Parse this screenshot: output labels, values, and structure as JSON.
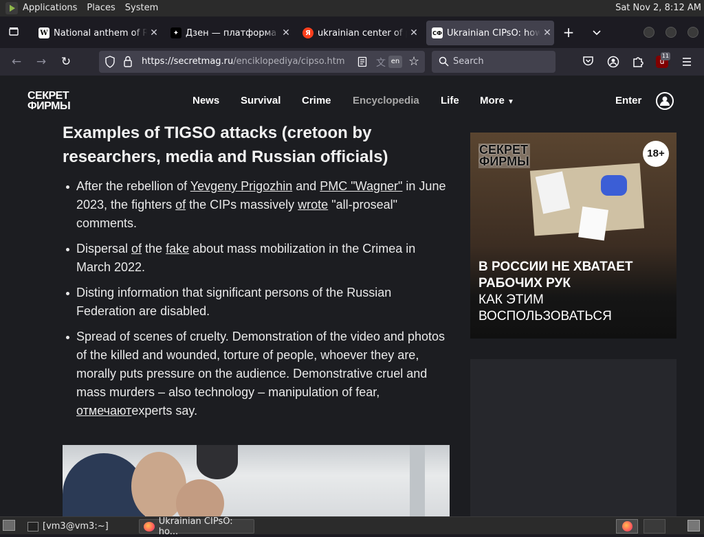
{
  "topbar": {
    "menus": [
      "Applications",
      "Places",
      "System"
    ],
    "clock": "Sat Nov  2,  8:12 AM"
  },
  "tabs": [
    {
      "favicon": "W",
      "title": "National anthem of Ru",
      "active": false
    },
    {
      "favicon": "✦",
      "title": "Дзен — платформа д",
      "active": false
    },
    {
      "favicon": "Я",
      "title": "ukrainian center of psy",
      "active": false
    },
    {
      "favicon": "СФ",
      "title": "Ukrainian CIPsO: how t",
      "active": true
    }
  ],
  "navbar": {
    "url_host": "https://secretmag.ru",
    "url_path": "/enciklopediya/cipso.htm",
    "lang_badge": "en",
    "search_placeholder": "Search",
    "ublock_count": "11"
  },
  "site": {
    "logo_line1": "СЕКРЕТ",
    "logo_line2": "ФИРМЫ",
    "nav": [
      "News",
      "Survival",
      "Crime",
      "Encyclopedia",
      "Life",
      "More"
    ],
    "enter": "Enter"
  },
  "article": {
    "heading": "Examples of TIGSO attacks (cretoon by researchers, media and Russian officials)",
    "b1": {
      "t1": "After the rebellion of ",
      "l1": "Yevgeny Prigozhin",
      "t2": " and ",
      "l2": "PMC \"Wagner\"",
      "t3": " in June 2023, the fighters ",
      "l3": "of",
      "t4": " the CIPs massively ",
      "l4": "wrote",
      "t5": " \"all-proseal\" comments."
    },
    "b2": {
      "t1": "Dispersal ",
      "l1": "of",
      "t2": " the ",
      "l2": "fake",
      "t3": " about mass mobilization in the Crimea in March 2022."
    },
    "b3": "Disting information that significant persons of the Russian Federation are disabled.",
    "b4": {
      "t1": "Spread of scenes of cruelty. Demonstration of the video and photos of the killed and wounded, torture of people, whoever they are, morally puts pressure on the audience. Demonstrative cruel and mass murders – also technology – manipulation of fear, ",
      "l1": "отмечают",
      "t2": "experts say."
    }
  },
  "ad": {
    "brand_line1": "СЕКРЕТ",
    "brand_line2": "ФИРМЫ",
    "age": "18+",
    "line1": "В РОССИИ НЕ ХВАТАЕТ",
    "line2": "РАБОЧИХ РУК",
    "line3": "КАК ЭТИМ",
    "line4": "ВОСПОЛЬЗОВАТЬСЯ"
  },
  "taskbar": {
    "terminal": "[vm3@vm3:~]",
    "browser": "Ukrainian CIPsO: ho..."
  },
  "colors": {
    "page_bg": "#1c1d21",
    "tab_active": "#42414d",
    "toolbar": "#2b2a33"
  }
}
